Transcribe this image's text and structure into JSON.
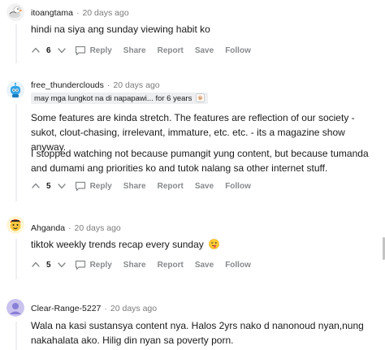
{
  "comments": [
    {
      "author": "itoangtama",
      "time": "20 days ago",
      "body": [
        "hindi na siya ang sunday viewing habit ko"
      ],
      "score": "6",
      "actions": {
        "reply": "Reply",
        "share": "Share",
        "report": "Report",
        "save": "Save",
        "follow": "Follow"
      }
    },
    {
      "author": "free_thunderclouds",
      "time": "20 days ago",
      "flair": "may mga lungkot na di napapawi... for 6 years",
      "body": [
        "Some features are kinda stretch. The features are reflection of our society - sukot, clout-chasing, irrelevant, immature, etc. etc. - its a magazine show anyway.",
        "I stopped watching not because pumangit yung content, but because tumanda and dumami ang priorities ko and tutok nalang sa other internet stuff."
      ],
      "score": "5",
      "actions": {
        "reply": "Reply",
        "share": "Share",
        "report": "Report",
        "save": "Save",
        "follow": "Follow"
      }
    },
    {
      "author": "Ahganda",
      "time": "20 days ago",
      "body": [
        "tiktok weekly trends recap every sunday"
      ],
      "emoji": "face-with-tongue",
      "score": "5",
      "actions": {
        "reply": "Reply",
        "share": "Share",
        "report": "Report",
        "save": "Save",
        "follow": "Follow"
      }
    },
    {
      "author": "Clear-Range-5227",
      "time": "20 days ago",
      "body": [
        "Wala na kasi sustansya content nya. Halos 2yrs nako d nanonoud nyan,nung nakahalata ako. Hilig din nyan sa poverty porn."
      ]
    }
  ],
  "colors": {
    "text": "#1a1a1b",
    "meta": "#7c7c7c",
    "action": "#878a8c",
    "flair_bg": "#edeff1"
  }
}
